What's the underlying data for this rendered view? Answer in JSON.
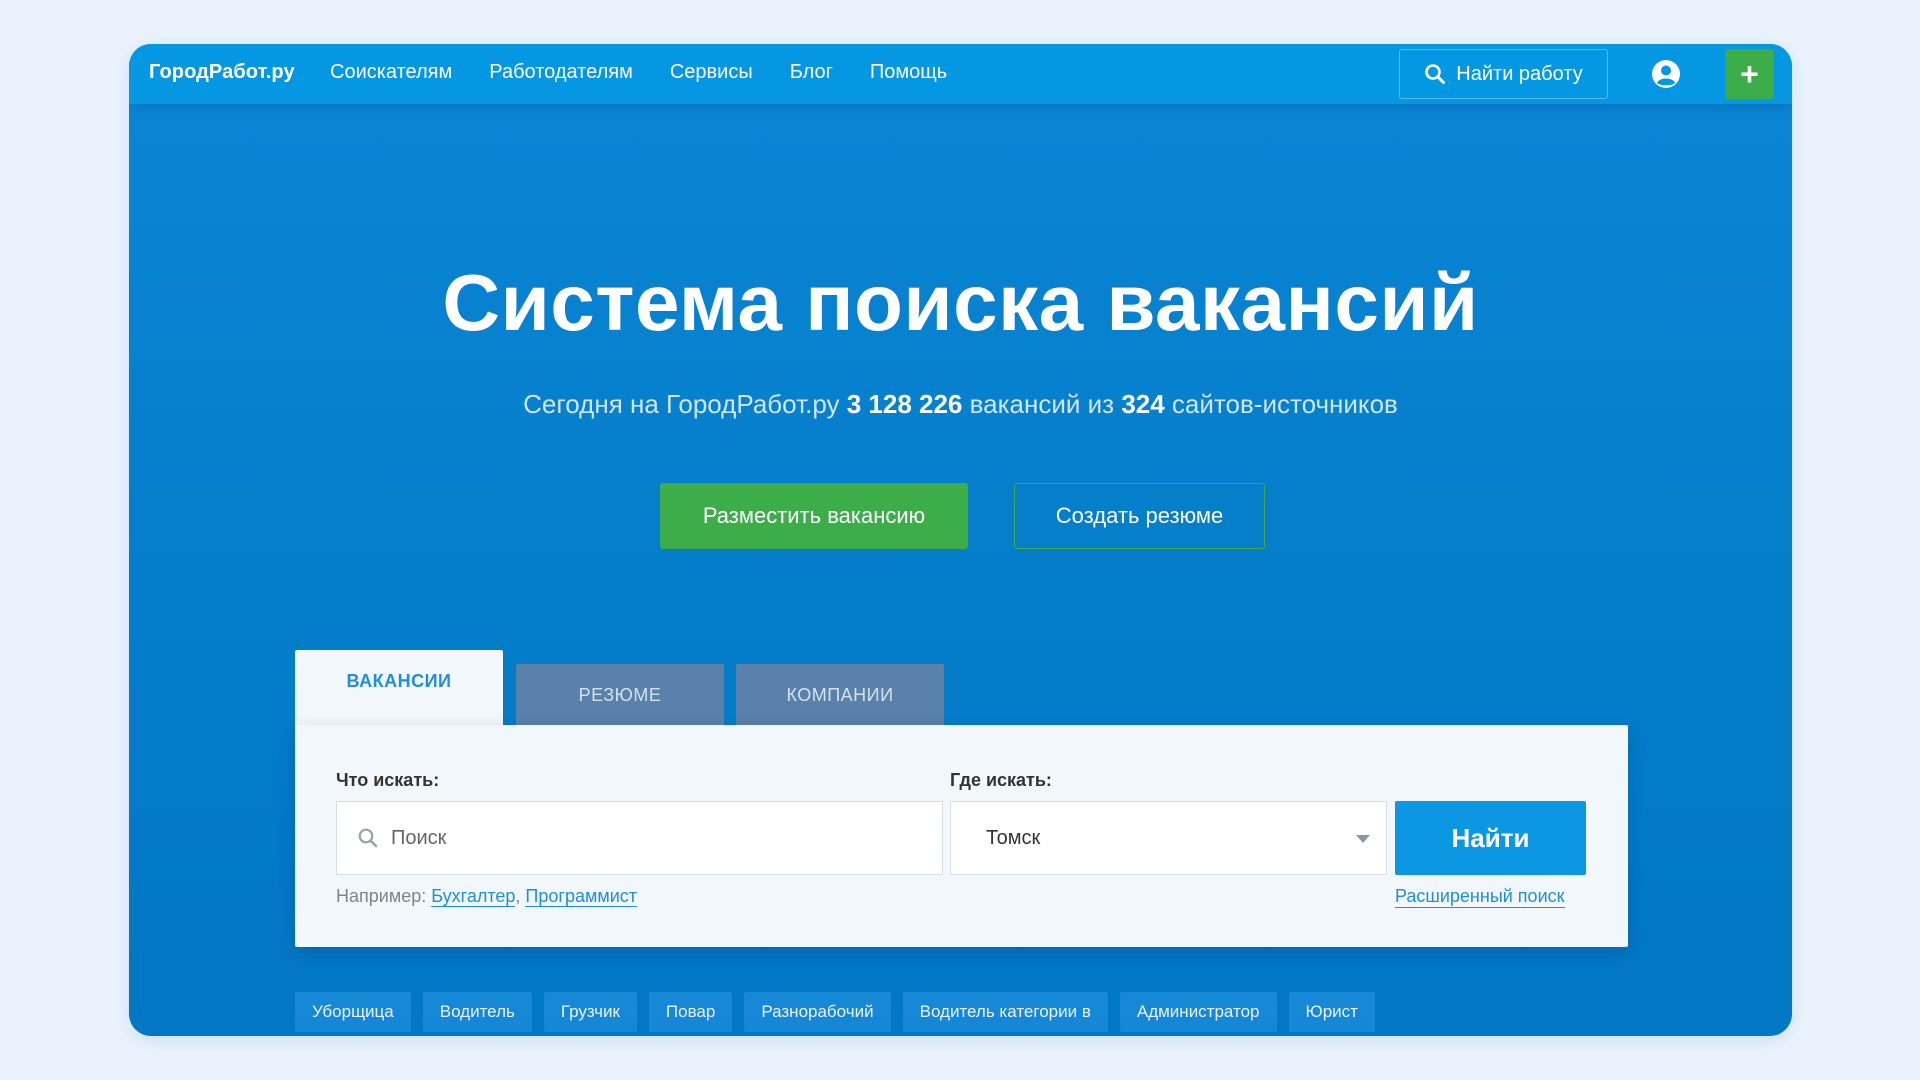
{
  "nav": {
    "logo": "ГородРабот.ру",
    "links": [
      "Соискателям",
      "Работодателям",
      "Сервисы",
      "Блог",
      "Помощь"
    ],
    "find_job_label": "Найти работу",
    "plus_label": "+"
  },
  "hero": {
    "title": "Система поиска вакансий",
    "subtitle_prefix": "Сегодня на ГородРабот.ру ",
    "vacancy_count": "3 128 226",
    "subtitle_middle": " вакансий из ",
    "source_count": "324",
    "subtitle_suffix": " сайтов-источников",
    "post_vacancy_label": "Разместить вакансию",
    "create_resume_label": "Создать резюме"
  },
  "tabs": [
    "ВАКАНСИИ",
    "РЕЗЮМЕ",
    "КОМПАНИИ"
  ],
  "search": {
    "what_label": "Что искать:",
    "where_label": "Где искать:",
    "query_placeholder": "Поиск",
    "location_value": "Томск",
    "find_label": "Найти",
    "examples_prefix": "Например: ",
    "example_1": "Бухгалтер",
    "example_separator": ", ",
    "example_2": "Программист",
    "advanced_label": "Расширенный поиск"
  },
  "tags": [
    "Уборщица",
    "Водитель",
    "Грузчик",
    "Повар",
    "Разнорабочий",
    "Водитель категории в",
    "Администратор",
    "Юрист"
  ],
  "colors": {
    "background": "#eaf3fd",
    "brand_blue": "#0597e2",
    "hero_blue": "#057ec9",
    "accent_green": "#3cad49",
    "inactive_tab": "#5981a9",
    "link_blue": "#1d8fdb"
  },
  "icons": {
    "find_job": "search-icon",
    "user": "user-circle-icon",
    "add": "plus-icon",
    "query": "search-icon",
    "location": "chevron-down-icon"
  }
}
